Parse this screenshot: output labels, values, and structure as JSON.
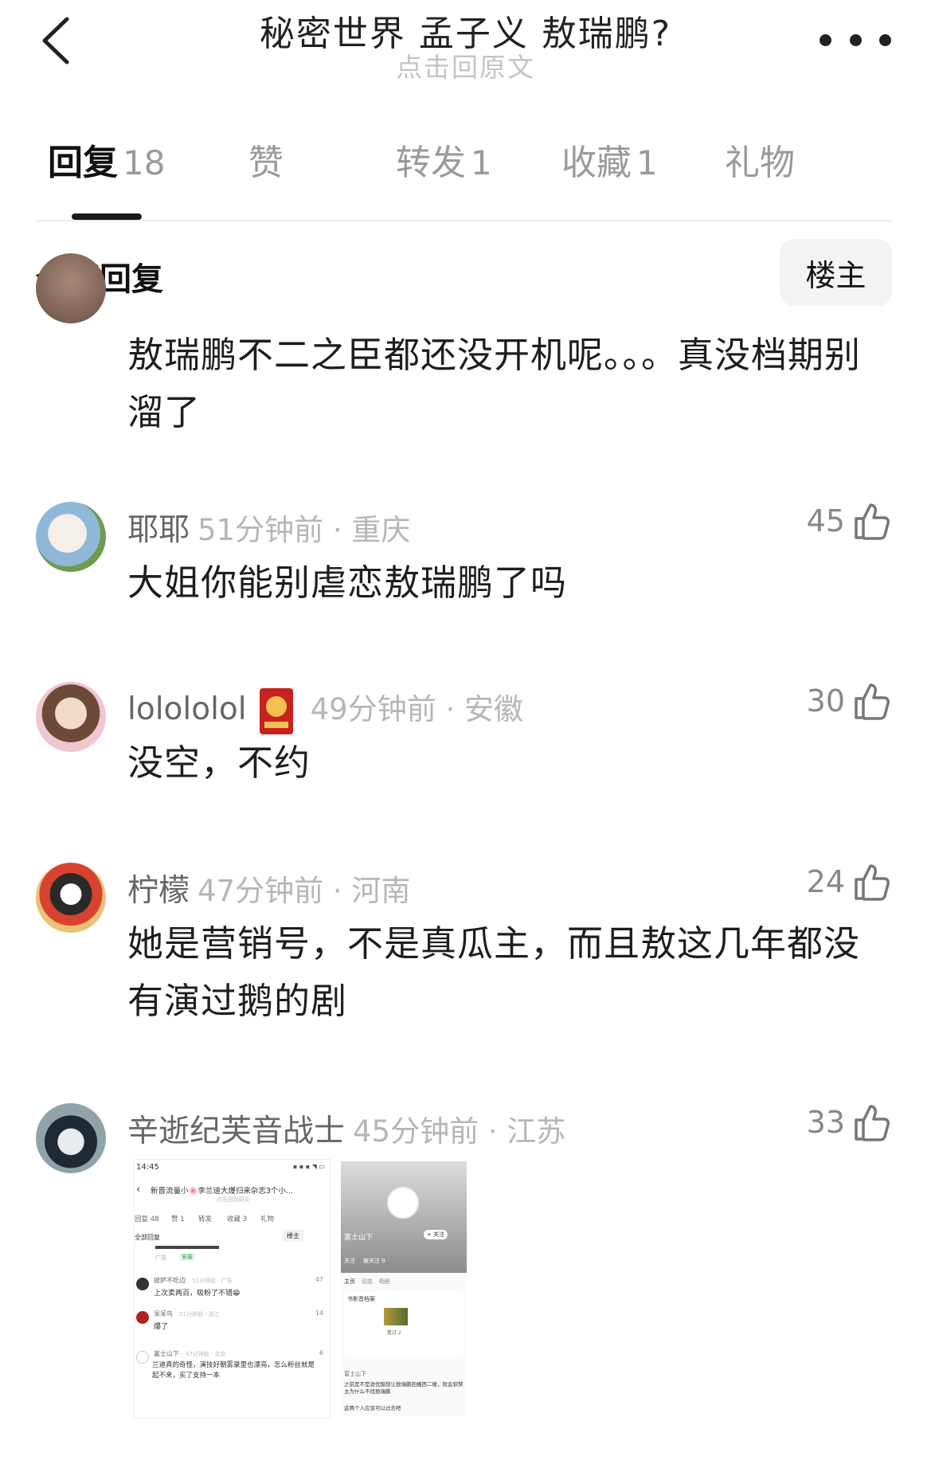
{
  "header": {
    "title": "秘密世界 孟子义 敖瑞鹏?",
    "subtitle": "点击回原文"
  },
  "tabs": [
    {
      "label": "回复",
      "count": "18"
    },
    {
      "label": "赞",
      "count": ""
    },
    {
      "label": "转发",
      "count": "1"
    },
    {
      "label": "收藏",
      "count": "1"
    },
    {
      "label": "礼物",
      "count": ""
    }
  ],
  "section": {
    "title": "全部回复",
    "owner_button": "楼主"
  },
  "comments": [
    {
      "name": "",
      "time": "",
      "likes": "",
      "text": "敖瑞鹏不二之臣都还没开机呢。。。真没档期别溜了"
    },
    {
      "name": "耶耶",
      "time": "51分钟前 · 重庆",
      "likes": "45",
      "text": "大姐你能别虐恋敖瑞鹏了吗"
    },
    {
      "name": "lolololol",
      "time": "49分钟前 · 安徽",
      "likes": "30",
      "text": "没空，不约"
    },
    {
      "name": "柠檬",
      "time": "47分钟前 · 河南",
      "likes": "24",
      "text": "她是营销号，不是真瓜主，而且敖这几年都没有演过鹅的剧"
    },
    {
      "name": "辛逝纪芙音战士",
      "time": "45分钟前 · 江苏",
      "likes": "33",
      "text": ""
    }
  ],
  "embedded_screenshot_1": {
    "status_time": "14:45",
    "title": "新晋流量小🌸李兰迪大爆归来杂志3个小...",
    "subtitle": "点击回到原文",
    "tabs": [
      "回复 48",
      "赞 1",
      "转发",
      "收藏 3",
      "礼物"
    ],
    "section": "全部回复",
    "owner": "楼主",
    "ad": "广告",
    "ad_tag": "安装",
    "comments": [
      {
        "name": "披萨不吃边",
        "time": "52分钟前 · 广东",
        "likes": "47",
        "text": "上次卖两百，吸粉了不错😁"
      },
      {
        "name": "呆呆鸟",
        "time": "51分钟前 · 浙江",
        "likes": "14",
        "text": "爆了"
      },
      {
        "name": "富士山下",
        "time": "47分钟前 · 北京",
        "likes": "6",
        "text": "兰迪真的奇怪，演技好朝雾录里也漂亮，怎么粉丝就是起不来，买了支持一本"
      }
    ]
  },
  "embedded_screenshot_2": {
    "profile_name": "富士山下",
    "follow": "+ 关注",
    "stats": [
      "关注",
      "被关注 9"
    ],
    "tabs": [
      "主页",
      "动态",
      "相册"
    ],
    "card_title": "书影音档案",
    "card_item": "看过 2",
    "post_name": "富士山下",
    "post_text": "之前是不是说优酷想让敖瑞鹏回播西二楼，就会软禁主为什么不找敖瑞鹏",
    "post_text2": "这两个人应该可以过去吧"
  },
  "colors": {
    "text_primary": "#1e1e1e",
    "text_secondary": "#9a9a9a",
    "meta": "#b6b6b6",
    "tab_active": "#111111",
    "owner_button_bg": "#f3f3f3"
  }
}
